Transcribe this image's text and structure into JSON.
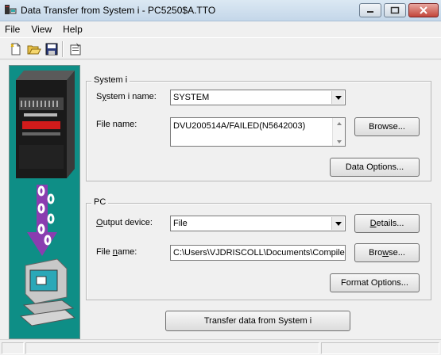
{
  "window": {
    "title": "Data Transfer from System i - PC5250$A.TTO"
  },
  "menu": [
    "File",
    "View",
    "Help"
  ],
  "toolbar": {
    "buttons": [
      "new-icon",
      "open-icon",
      "save-icon",
      "properties-icon"
    ]
  },
  "system_group": {
    "title": "System i",
    "system_name_label_underlined": "y",
    "system_name_label_rest": "stem i name:",
    "system_name_label_prefix": "S",
    "system_name_value": "SYSTEM",
    "file_name_label": "File name:",
    "file_name_value": "DVU200514A/FAILED(N5642003)",
    "browse_label": "Browse...",
    "data_options_label": "Data Options..."
  },
  "pc_group": {
    "title": "PC",
    "output_label_prefix": "O",
    "output_label_rest": "utput device:",
    "output_value": "File",
    "details_label": "Details...",
    "details_prefix": "D",
    "details_rest": "etails...",
    "file_name_label_prefix": "File ",
    "file_name_label_underlined": "n",
    "file_name_label_rest": "ame:",
    "file_name_value": "C:\\Users\\VJDRISCOLL\\Documents\\Compile c",
    "browse_prefix": "Bro",
    "browse_underlined": "w",
    "browse_rest": "se...",
    "format_options_label": "Format Options..."
  },
  "transfer_button_label": "Transfer data from System i"
}
